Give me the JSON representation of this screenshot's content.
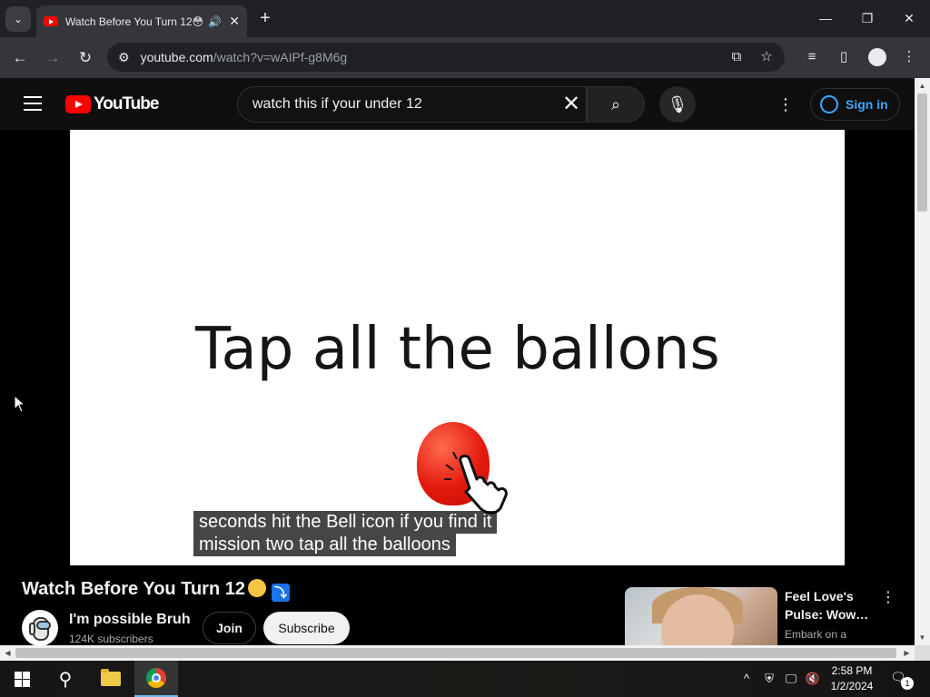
{
  "browser": {
    "tab": {
      "title": "Watch Before You Turn 12😳 ⤵️"
    },
    "url_host": "youtube.com",
    "url_path": "/watch?v=wAIPf-g8M6g"
  },
  "youtube": {
    "logo_text": "YouTube",
    "search": {
      "value": "watch this if your under 12"
    },
    "signin_label": "Sign in"
  },
  "video": {
    "on_screen_text": "Tap all the ballons",
    "captions": [
      "seconds hit the Bell icon if you find it",
      "mission two tap all the balloons"
    ],
    "title": "Watch Before You Turn 12",
    "channel_name": "I'm possible Bruh",
    "subscribers": "124K subscribers",
    "join_label": "Join",
    "subscribe_label": "Subscribe"
  },
  "recommendation": {
    "title": "Feel Love's Pulse: Wow…",
    "desc": "Embark on a"
  },
  "taskbar": {
    "time": "2:58 PM",
    "date": "1/2/2024",
    "notification_count": "1"
  }
}
